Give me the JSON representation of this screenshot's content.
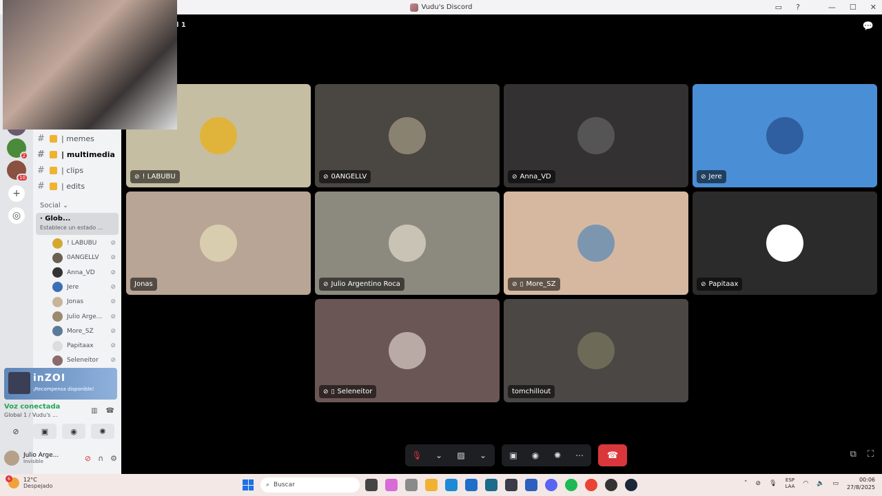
{
  "window": {
    "title": "Vudu's Discord"
  },
  "header": {
    "channel_label": "l 1"
  },
  "guilds": [
    {
      "color": "#c88c8c",
      "badge": ""
    },
    {
      "color": "#556677",
      "badge": ""
    },
    {
      "color": "#a09080",
      "badge": "4"
    },
    {
      "color": "#7a4a3a",
      "badge": "1"
    },
    {
      "color": "#6a5a70",
      "badge": ""
    },
    {
      "color": "#4a8a3a",
      "badge": "2"
    },
    {
      "color": "#8a5040",
      "badge": "10"
    }
  ],
  "channels": [
    {
      "name": "| memes",
      "bold": false
    },
    {
      "name": "| multimedia",
      "bold": true
    },
    {
      "name": "| clips",
      "bold": false
    },
    {
      "name": "| edits",
      "bold": false
    }
  ],
  "category": "Social ⌄",
  "voice_channel": {
    "name": "· Glob...",
    "status": "Establece un estado ..."
  },
  "voice_users": [
    {
      "name": "! LABUBU",
      "color": "#d4a830"
    },
    {
      "name": "0ANGELLV",
      "color": "#6a6050"
    },
    {
      "name": "Anna_VD",
      "color": "#333"
    },
    {
      "name": "Jere",
      "color": "#3b6fb5"
    },
    {
      "name": "Jonas",
      "color": "#c8b49a"
    },
    {
      "name": "Julio Arge...",
      "color": "#9a8a70"
    },
    {
      "name": "More_SZ",
      "color": "#5a7a9a"
    },
    {
      "name": "Papitaax",
      "color": "#ddd"
    },
    {
      "name": "Seleneitor",
      "color": "#8a6a6a"
    }
  ],
  "promo": {
    "title": "inZOI",
    "subtitle": "¡Recompensa disponible!"
  },
  "voice_panel": {
    "status": "Voz conectada",
    "location": "Global 1 / Vudu's ..."
  },
  "user_panel": {
    "name": "Julio Arge...",
    "status": "Invisible"
  },
  "tiles": [
    {
      "name": "! LABUBU",
      "bg": "#c6bea3",
      "avatar": "#e0b43a",
      "muted": true,
      "mobile": false,
      "col": 0,
      "row": 0
    },
    {
      "name": "0ANGELLV",
      "bg": "#4a4641",
      "avatar": "#8a8270",
      "muted": true,
      "mobile": false,
      "col": 1,
      "row": 0
    },
    {
      "name": "Anna_VD",
      "bg": "#333132",
      "avatar": "#555",
      "muted": true,
      "mobile": false,
      "col": 2,
      "row": 0
    },
    {
      "name": "Jere",
      "bg": "#4a8fd6",
      "avatar": "#2f5fa0",
      "muted": true,
      "mobile": false,
      "col": 3,
      "row": 0
    },
    {
      "name": "Jonas",
      "bg": "#b8a595",
      "avatar": "#d9cdb0",
      "muted": false,
      "mobile": false,
      "col": 0,
      "row": 1
    },
    {
      "name": "Julio Argentino Roca",
      "bg": "#8c8a7e",
      "avatar": "#c9c3b5",
      "muted": true,
      "mobile": false,
      "col": 1,
      "row": 1
    },
    {
      "name": "More_SZ",
      "bg": "#d6b8a1",
      "avatar": "#7d96b0",
      "muted": true,
      "mobile": true,
      "col": 2,
      "row": 1
    },
    {
      "name": "Papitaax",
      "bg": "#2b2b2b",
      "avatar": "#ffffff",
      "muted": true,
      "mobile": false,
      "col": 3,
      "row": 1
    },
    {
      "name": "Seleneitor",
      "bg": "#6b5656",
      "avatar": "#b9aaa5",
      "muted": true,
      "mobile": true,
      "col": 1,
      "row": 2
    },
    {
      "name": "tomchillout",
      "bg": "#4a4744",
      "avatar": "#6d6a58",
      "muted": false,
      "mobile": false,
      "col": 2,
      "row": 2
    }
  ],
  "taskbar": {
    "weather_temp": "12°C",
    "weather_desc": "Despejado",
    "weather_badge": "6",
    "search_placeholder": "Buscar",
    "lang1": "ESP",
    "lang2": "LAA",
    "time": "00:06",
    "date": "27/8/2025",
    "apps": [
      "#444",
      "#d96bd6",
      "#8a8a8a",
      "#f0b232",
      "#1e8ad6",
      "#1f6fc8",
      "#1c6b8a",
      "#3a3a4a",
      "#2d5fbf",
      "#5865f2",
      "#1db954",
      "#ea4335",
      "#333",
      "#1b2838"
    ]
  }
}
